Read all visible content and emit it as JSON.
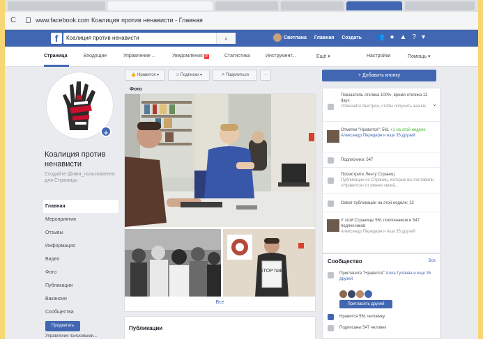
{
  "browser": {
    "url": "www.facebook.com Коалиция против ненависти - Главная",
    "nav_glyph": "C"
  },
  "topbar": {
    "search_value": "Коалиция против ненависти",
    "search_icon": "search-icon",
    "user_name": "Светлана",
    "home_label": "Главная",
    "create_label": "Создать"
  },
  "tabs": [
    {
      "label": "Страница"
    },
    {
      "label": "Входящие"
    },
    {
      "label": "Управление ..."
    },
    {
      "label": "Уведомления"
    },
    {
      "label": "Статистика"
    },
    {
      "label": "Инструмент..."
    },
    {
      "label": "Ещё ▾"
    },
    {
      "label": "Настройки"
    },
    {
      "label": "Помощь ▾"
    }
  ],
  "notif_count": "8",
  "page": {
    "name": "Коалиция против ненависти",
    "tagline": "Создайте @имя_пользователя для Страницы"
  },
  "left_nav": [
    {
      "label": "Главная"
    },
    {
      "label": "Мероприятия"
    },
    {
      "label": "Отзывы"
    },
    {
      "label": "Информация"
    },
    {
      "label": "Видео"
    },
    {
      "label": "Фото"
    },
    {
      "label": "Публикации"
    },
    {
      "label": "Вакансии"
    },
    {
      "label": "Сообщества"
    }
  ],
  "promote": {
    "button": "Продвигать",
    "text": "Управление поисковыми..."
  },
  "actions": {
    "like": "Нравится ▾",
    "follow": "Подписки ▾",
    "share": "Поделиться",
    "more": "···"
  },
  "photos": {
    "label": "Фото",
    "see_all": "Все",
    "sign_text": "STOP hate"
  },
  "publications_title": "Публикации",
  "add_button": "+ Добавить кнопку",
  "sidebar": {
    "response_rate": "Показатель отклика 100%, время отклика 12 days",
    "response_sub": "Отвечайте быстрее, чтобы получить значок",
    "likes_title": "Отметки \"Нравится\": 561",
    "likes_week": "+1 на этой неделе",
    "likes_friends": "Александр Передерн и еще 35 друзей",
    "followers": "Подписчики: 547",
    "feed_title": "Посмотрите Ленту Страниц",
    "feed_sub": "Публикации со Страниц, которые вы поставили «Нравится» от имени своей...",
    "reach": "Охват публикации на этой неделе: 22",
    "page_stats": "У этой Страницы 561 поклонников и 547 подписчиков",
    "page_stats_sub": "Александр Передерн и еще 35 друзей"
  },
  "community": {
    "title": "Сообщество",
    "see_all": "Все",
    "invite_text_prefix": "Пригласите \"Нравится\" ",
    "invite_names": "Алла Гуляева и еще 35 друзей",
    "invite_button": "Пригласить друзей",
    "likes": "Нравится 561 человеку",
    "follows": "Подписаны 547 человек"
  },
  "colors": {
    "brand": "#4267b2",
    "background": "#e9ebee",
    "outer_frame": "#f7d774"
  }
}
